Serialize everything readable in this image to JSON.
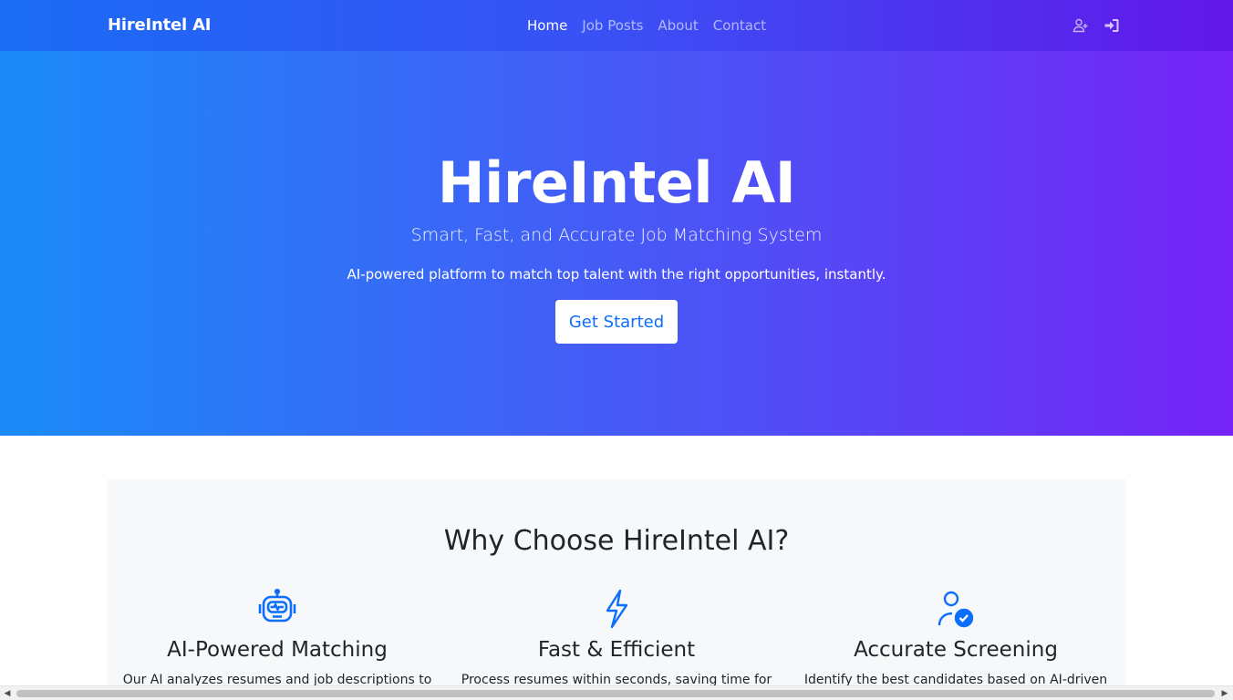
{
  "nav": {
    "brand": "HireIntel AI",
    "links": [
      {
        "label": "Home",
        "active": true
      },
      {
        "label": "Job Posts",
        "active": false
      },
      {
        "label": "About",
        "active": false
      },
      {
        "label": "Contact",
        "active": false
      }
    ],
    "icons": [
      "user-plus-icon",
      "sign-in-icon"
    ]
  },
  "hero": {
    "title": "HireIntel AI",
    "subtitle": "Smart, Fast, and Accurate Job Matching System",
    "description": "AI-powered platform to match top talent with the right opportunities, instantly.",
    "cta_label": "Get Started"
  },
  "features": {
    "title": "Why Choose HireIntel AI?",
    "items": [
      {
        "icon": "robot-icon",
        "title": "AI-Powered Matching",
        "description": "Our AI analyzes resumes and job descriptions to"
      },
      {
        "icon": "lightning-icon",
        "title": "Fast & Efficient",
        "description": "Process resumes within seconds, saving time for"
      },
      {
        "icon": "person-check-icon",
        "title": "Accurate Screening",
        "description": "Identify the best candidates based on AI-driven"
      }
    ]
  },
  "colors": {
    "accent": "#0d6efd",
    "nav_gradient_start": "#1a6cf5",
    "nav_gradient_end": "#6217e9",
    "hero_gradient_start": "#1a8bf8",
    "hero_gradient_end": "#7523f6"
  }
}
